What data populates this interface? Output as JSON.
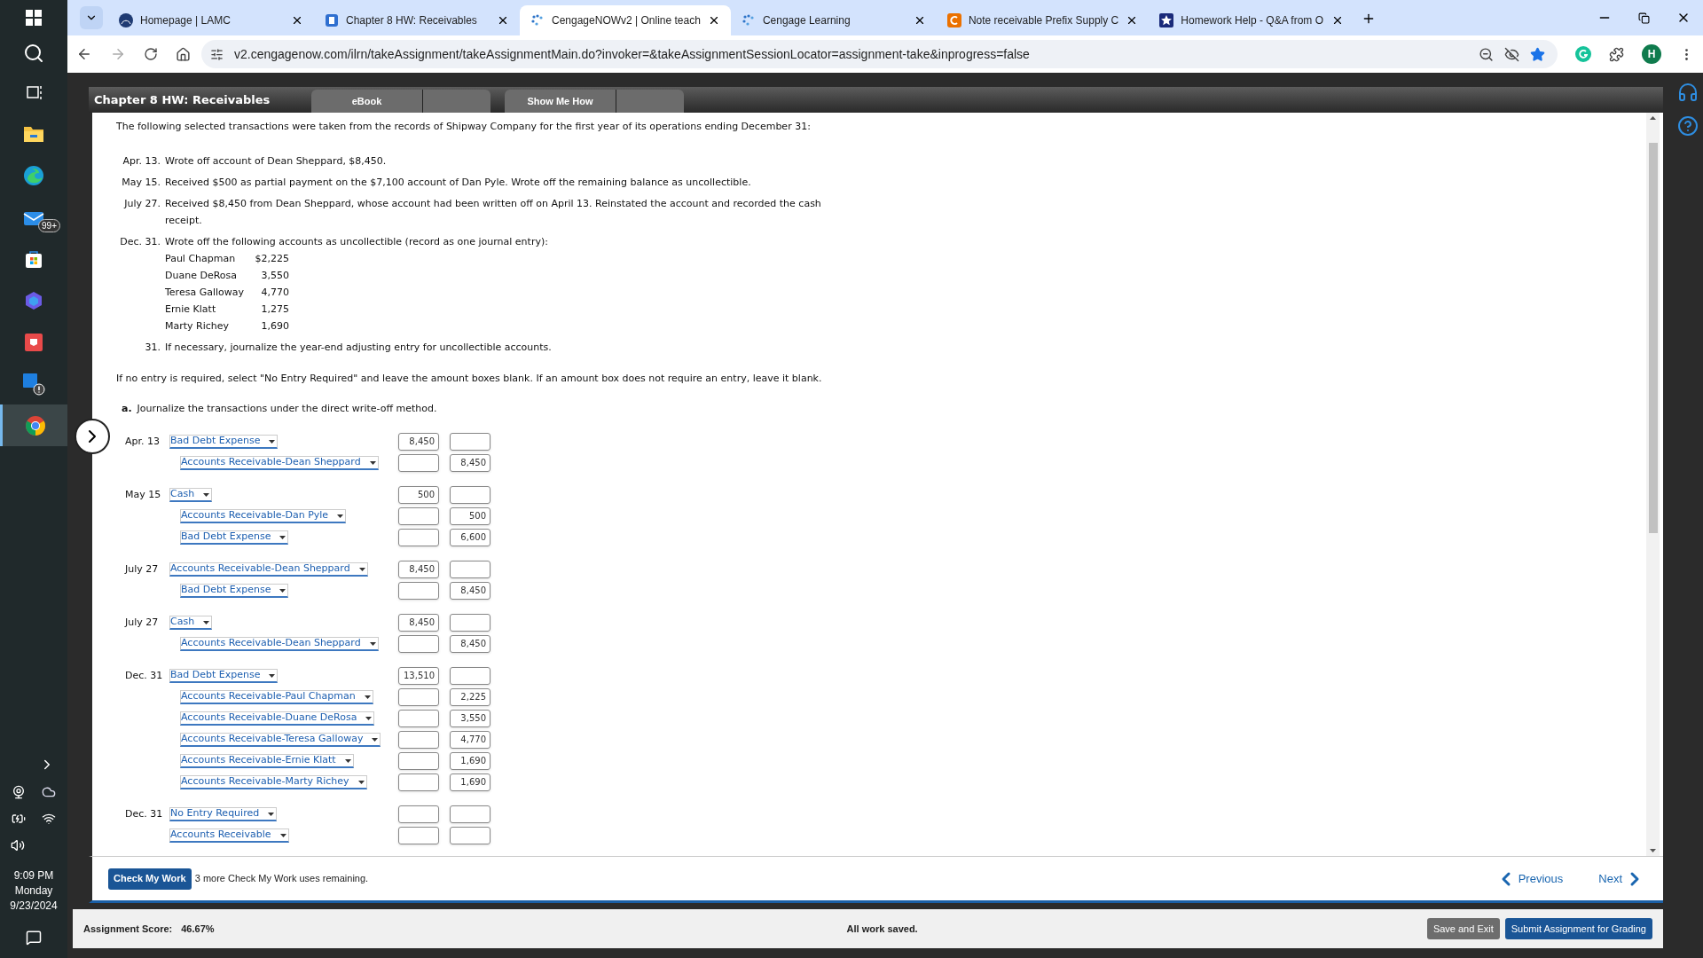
{
  "taskbar": {
    "apps": [
      {
        "kind": "task-view",
        "selected": false
      },
      {
        "kind": "folder",
        "selected": false
      },
      {
        "kind": "edge",
        "selected": false
      },
      {
        "kind": "mail",
        "selected": false,
        "badge": "99+"
      },
      {
        "kind": "store",
        "selected": false
      },
      {
        "kind": "copilot",
        "selected": false
      },
      {
        "kind": "red-app",
        "selected": false
      },
      {
        "kind": "alert-app",
        "selected": false
      },
      {
        "kind": "chrome",
        "selected": true
      }
    ],
    "clock": {
      "time": "9:09 PM",
      "day": "Monday",
      "date": "9/23/2024"
    }
  },
  "browser": {
    "tabs": [
      {
        "title": "Homepage | LAMC",
        "selected": false,
        "kind": "lamc"
      },
      {
        "title": "Chapter 8 HW: Receivables",
        "selected": false,
        "kind": "book"
      },
      {
        "title": "CengageNOWv2 | Online teach",
        "selected": true,
        "kind": "cengage"
      },
      {
        "title": "Cengage Learning",
        "selected": false,
        "kind": "cengage"
      },
      {
        "title": "Note receivable Prefix Supply C",
        "selected": false,
        "kind": "chegg"
      },
      {
        "title": "Homework Help - Q&A from O",
        "selected": false,
        "kind": "star"
      }
    ],
    "url": "v2.cengagenow.com/ilrn/takeAssignment/takeAssignmentMain.do?invoker=&takeAssignmentSessionLocator=assignment-take&inprogress=false",
    "profile": "H"
  },
  "assignment": {
    "title": "Chapter 8 HW: Receivables",
    "header_buttons": [
      "eBook",
      "Show Me How"
    ],
    "intro": "The following selected transactions were taken from the records of Shipway Company for the first year of its operations ending December 31:",
    "transactions": [
      {
        "date": "Apr. 13.",
        "text": "Wrote off account of Dean Sheppard, $8,450."
      },
      {
        "date": "May 15.",
        "text": "Received $500 as partial payment on the $7,100 account of Dan Pyle. Wrote off the remaining balance as uncollectible."
      },
      {
        "date": "July 27.",
        "text": "Received $8,450 from Dean Sheppard, whose account had been written off on April 13. Reinstated the account and recorded the cash receipt."
      },
      {
        "date": "Dec. 31.",
        "text": "Wrote off the following accounts as uncollectible (record as one journal entry):"
      }
    ],
    "accounts": [
      {
        "name": "Paul Chapman",
        "amount": "$2,225"
      },
      {
        "name": "Duane DeRosa",
        "amount": "3,550"
      },
      {
        "name": "Teresa Galloway",
        "amount": "4,770"
      },
      {
        "name": "Ernie Klatt",
        "amount": "1,275"
      },
      {
        "name": "Marty Richey",
        "amount": "1,690"
      }
    ],
    "final_item": {
      "date": "31.",
      "text": "If necessary, journalize the year-end adjusting entry for uncollectible accounts."
    },
    "instructions": "If no entry is required, select \"No Entry Required\" and leave the amount boxes blank. If an amount box does not require an entry, leave it blank.",
    "part": {
      "letter": "a.",
      "text": "Journalize the transactions under the direct write-off method."
    },
    "journal": [
      {
        "date": "Apr. 13",
        "lines": [
          {
            "account": "Bad Debt Expense",
            "indented": false,
            "debit": "8,450"
          },
          {
            "account": "Accounts Receivable-Dean Sheppard",
            "indented": true,
            "credit": "8,450"
          }
        ]
      },
      {
        "date": "May 15",
        "lines": [
          {
            "account": "Cash",
            "indented": false,
            "debit": "500"
          },
          {
            "account": "Accounts Receivable-Dan Pyle",
            "indented": true,
            "credit": "500"
          },
          {
            "account": "Bad Debt Expense",
            "indented": true,
            "credit": "6,600"
          }
        ]
      },
      {
        "date": "July 27",
        "lines": [
          {
            "account": "Accounts Receivable-Dean Sheppard",
            "indented": false,
            "debit": "8,450"
          },
          {
            "account": "Bad Debt Expense",
            "indented": true,
            "credit": "8,450"
          }
        ]
      },
      {
        "date": "July 27",
        "lines": [
          {
            "account": "Cash",
            "indented": false,
            "debit": "8,450"
          },
          {
            "account": "Accounts Receivable-Dean Sheppard",
            "indented": true,
            "credit": "8,450"
          }
        ]
      },
      {
        "date": "Dec. 31",
        "lines": [
          {
            "account": "Bad Debt Expense",
            "indented": false,
            "debit": "13,510"
          },
          {
            "account": "Accounts Receivable-Paul Chapman",
            "indented": true,
            "credit": "2,225"
          },
          {
            "account": "Accounts Receivable-Duane DeRosa",
            "indented": true,
            "credit": "3,550"
          },
          {
            "account": "Accounts Receivable-Teresa Galloway",
            "indented": true,
            "credit": "4,770"
          },
          {
            "account": "Accounts Receivable-Ernie Klatt",
            "indented": true,
            "credit": "1,690"
          },
          {
            "account": "Accounts Receivable-Marty Richey",
            "indented": true,
            "credit": "1,690"
          }
        ]
      },
      {
        "date": "Dec. 31",
        "lines": [
          {
            "account": "No Entry Required",
            "indented": false
          },
          {
            "account": "Accounts Receivable",
            "indented": false
          }
        ]
      }
    ],
    "check_button": "Check My Work",
    "remaining": "3 more Check My Work uses remaining.",
    "previous": "Previous",
    "next": "Next"
  },
  "status_bar": {
    "score_label": "Assignment Score:",
    "score": "46.67%",
    "saved": "All work saved.",
    "buttons": [
      "Save and Exit",
      "Submit Assignment for Grading"
    ]
  }
}
